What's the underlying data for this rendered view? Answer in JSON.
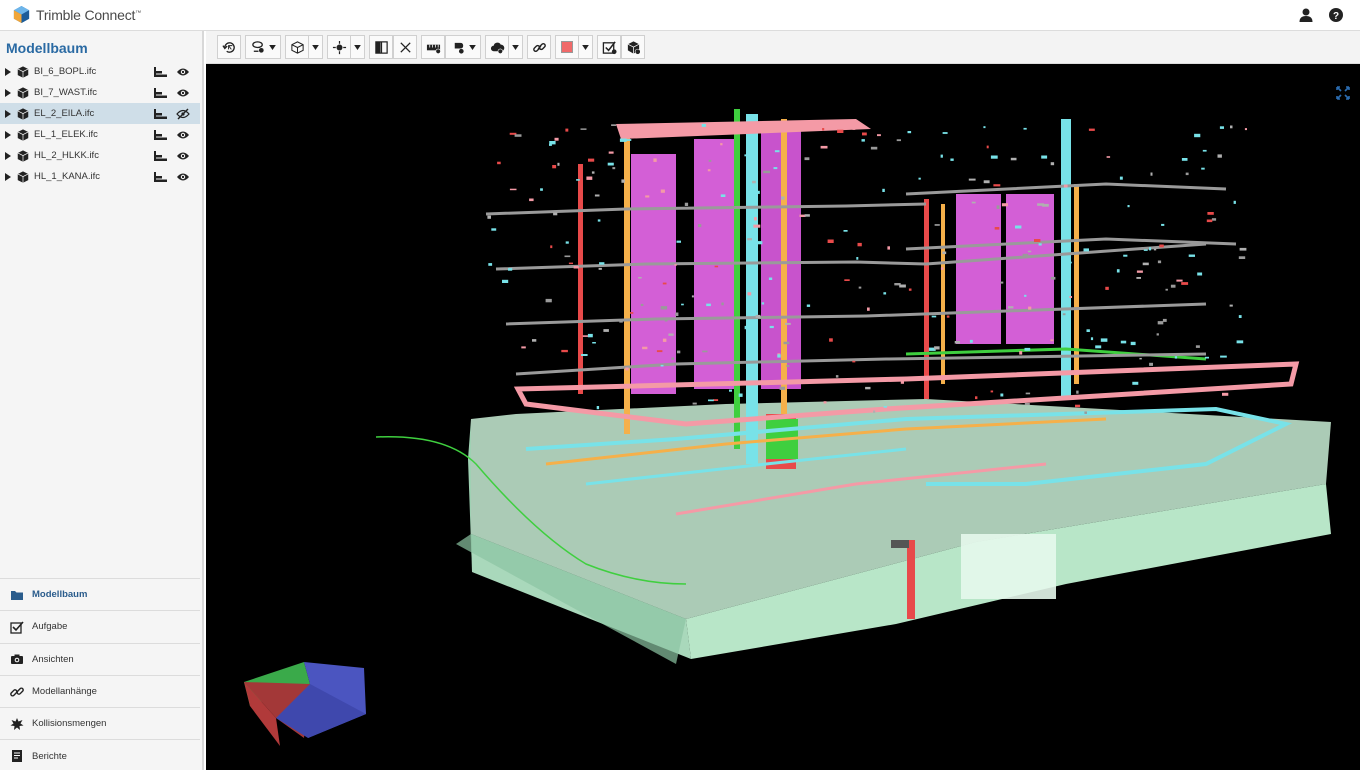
{
  "app": {
    "name": "Trimble Connect",
    "trademark": "™"
  },
  "header": {
    "user_icon": "user-icon",
    "help_icon": "help-icon"
  },
  "sidebar": {
    "title": "Modellbaum",
    "models": [
      {
        "label": "BI_6_BOPL.ifc",
        "visible": true,
        "selected": false
      },
      {
        "label": "BI_7_WAST.ifc",
        "visible": true,
        "selected": false
      },
      {
        "label": "EL_2_EILA.ifc",
        "visible": false,
        "selected": true
      },
      {
        "label": "EL_1_ELEK.ifc",
        "visible": true,
        "selected": false
      },
      {
        "label": "HL_2_HLKK.ifc",
        "visible": true,
        "selected": false
      },
      {
        "label": "HL_1_KANA.ifc",
        "visible": true,
        "selected": false
      }
    ],
    "nav": [
      {
        "label": "Modellbaum",
        "icon": "folder-icon",
        "active": true
      },
      {
        "label": "Aufgabe",
        "icon": "task-icon",
        "active": false
      },
      {
        "label": "Ansichten",
        "icon": "camera-icon",
        "active": false
      },
      {
        "label": "Modellanhänge",
        "icon": "link-icon",
        "active": false
      },
      {
        "label": "Kollisionsmengen",
        "icon": "collision-icon",
        "active": false
      },
      {
        "label": "Berichte",
        "icon": "report-icon",
        "active": false
      }
    ]
  },
  "toolbar": {
    "tools": [
      "rotate-icon",
      "walk-icon",
      "view-cube-icon",
      "focus-icon",
      "section-plane-icon",
      "clear-icon",
      "measure-icon",
      "markup-icon",
      "cloud-icon",
      "link-icon",
      "color-icon",
      "task-check-icon",
      "model-check-icon"
    ],
    "color_swatch": "#f06a6a"
  },
  "colors": {
    "accent": "#2a6aa3",
    "selected_row": "#cfdee8",
    "viewer_bg": "#000000",
    "slab": "#b8e6c8",
    "pink_pipe": "#f49aa6",
    "magenta_panel": "#d35fd6",
    "cyan_pipe": "#78e2e8",
    "orange_pipe": "#f5b04a",
    "red_element": "#e84a4a",
    "green_element": "#3fcf3f"
  }
}
